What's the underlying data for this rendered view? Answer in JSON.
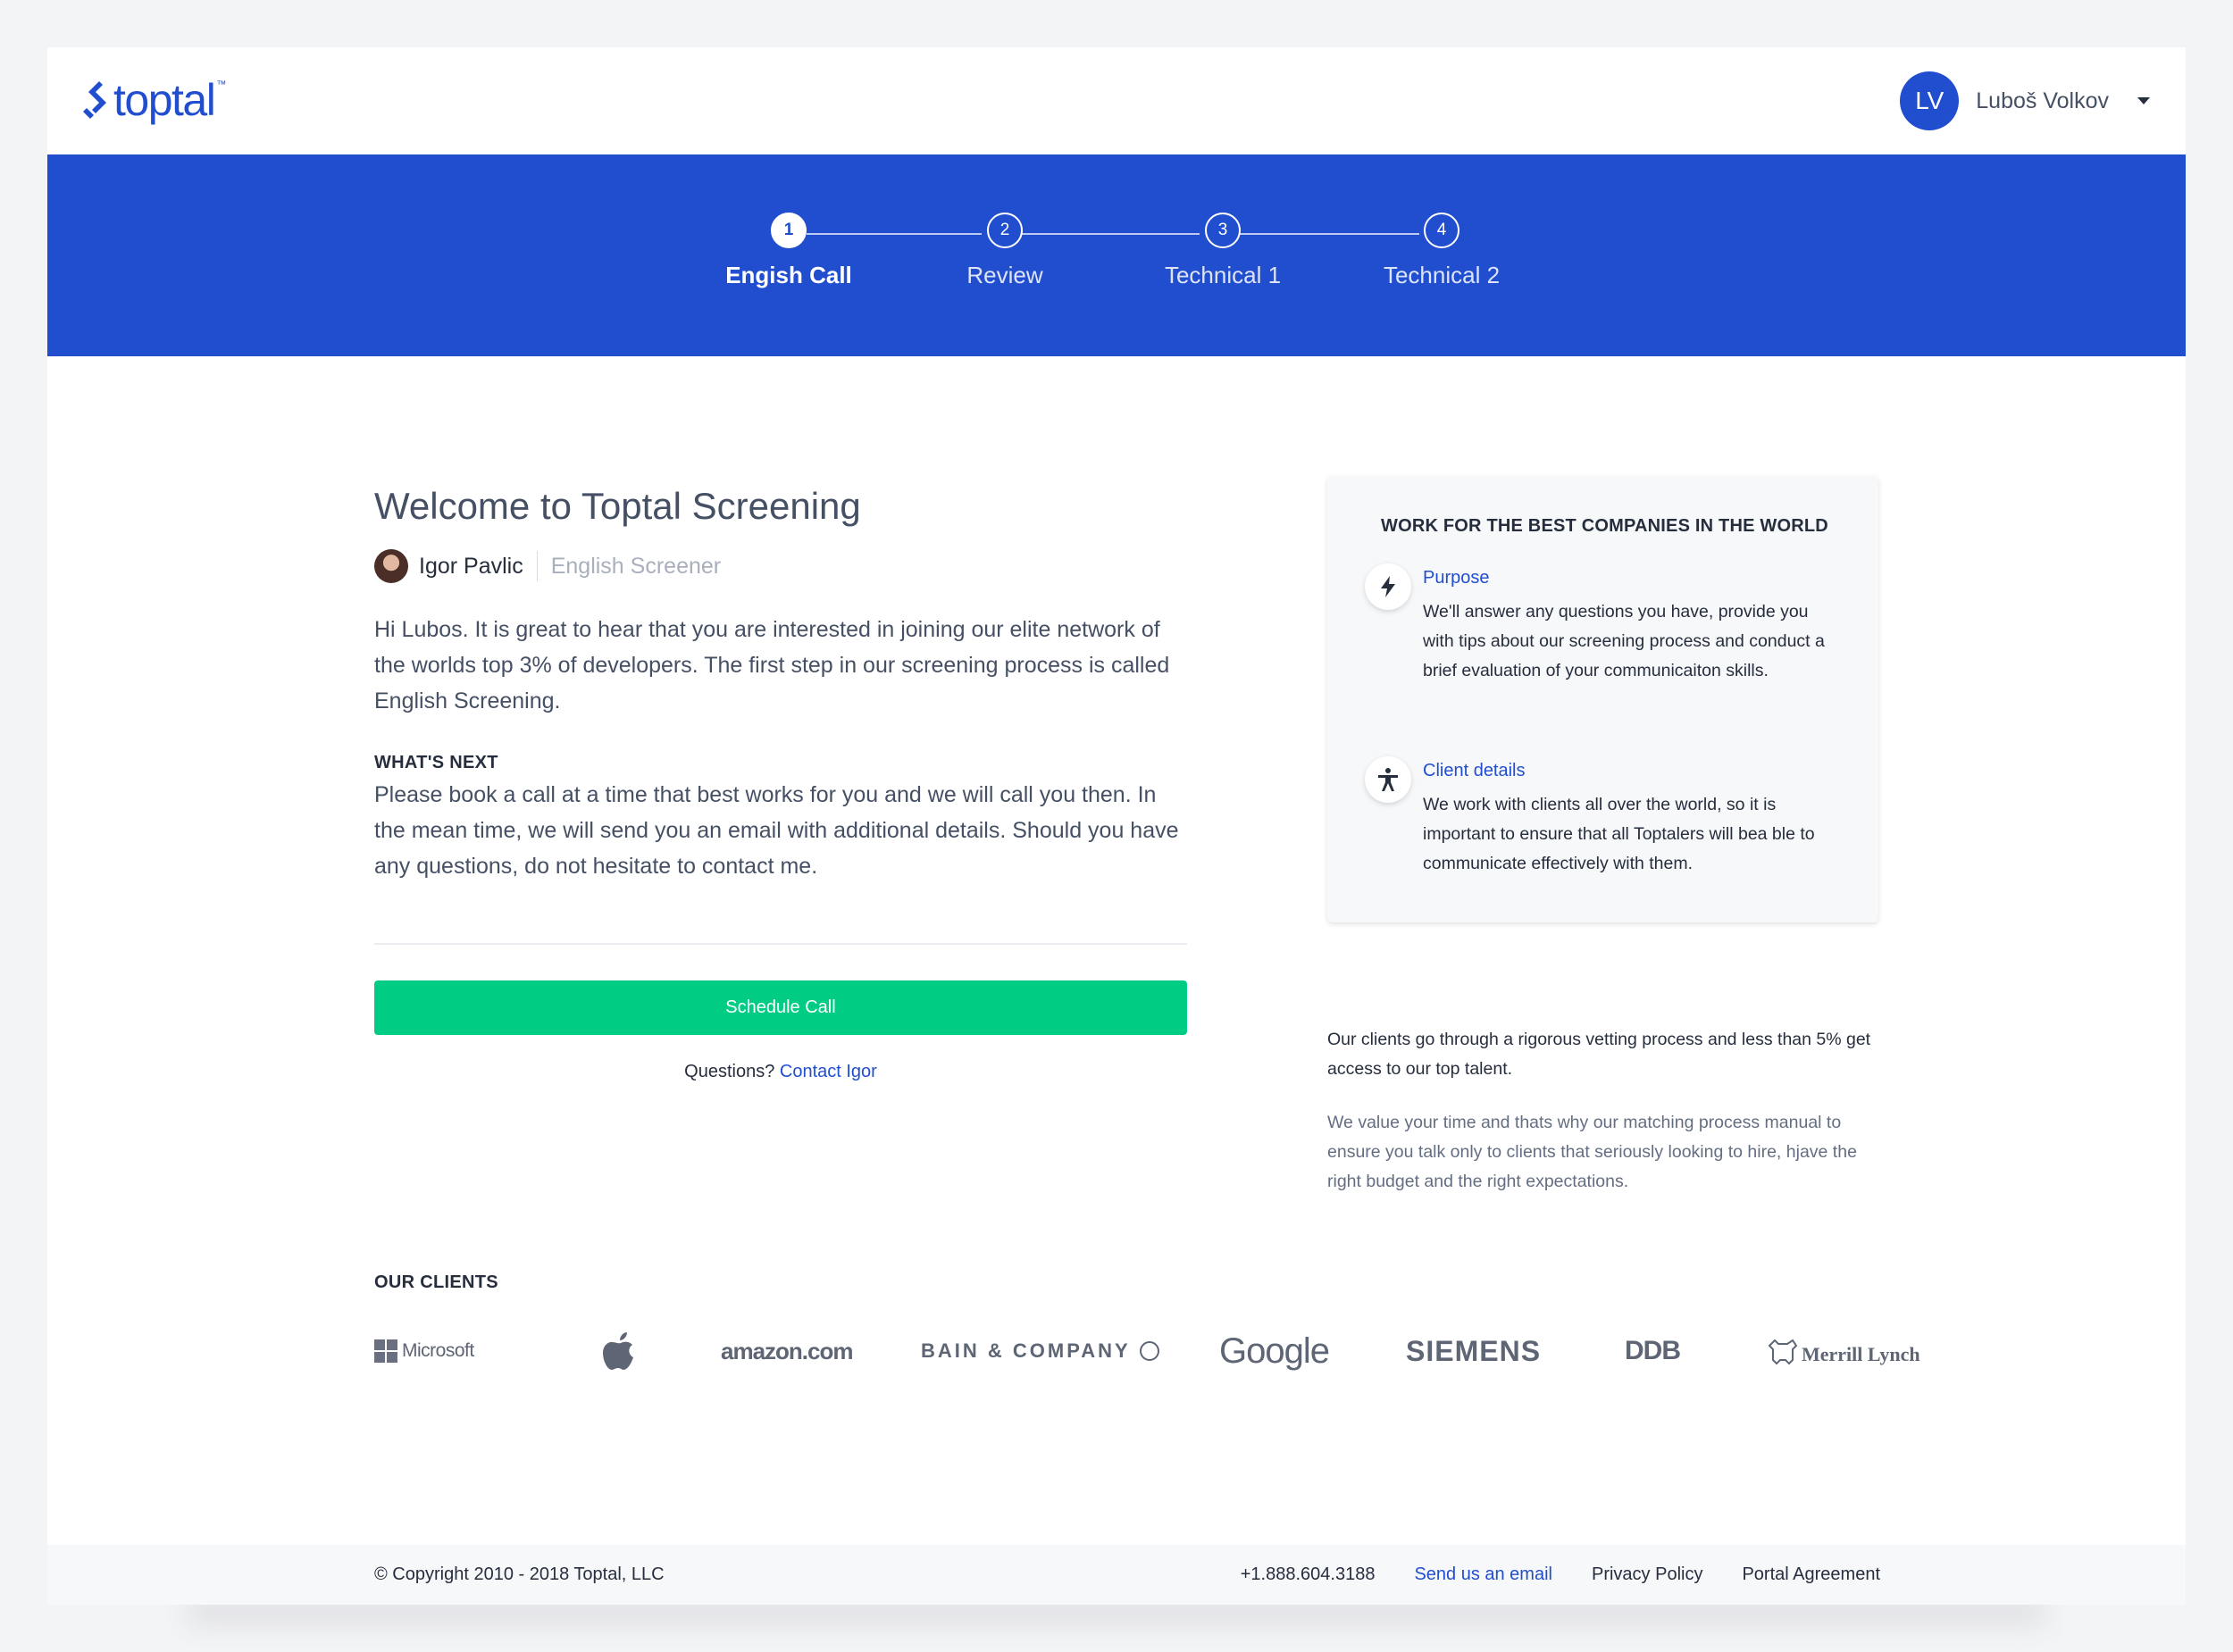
{
  "header": {
    "logo_text": "toptal",
    "logo_tm": "™",
    "user_initials": "LV",
    "user_name": "Luboš Volkov"
  },
  "steps": [
    {
      "number": "1",
      "label": "Engish Call",
      "active": true
    },
    {
      "number": "2",
      "label": "Review",
      "active": false
    },
    {
      "number": "3",
      "label": "Technical 1",
      "active": false
    },
    {
      "number": "4",
      "label": "Technical 2",
      "active": false
    }
  ],
  "main": {
    "title": "Welcome to Toptal Screening",
    "screener_name": "Igor Pavlic",
    "screener_role": "English Screener",
    "intro": "Hi Lubos. It is great to hear that you are interested in joining our elite network of the worlds top 3% of developers. The first step in our screening process is called English Screening.",
    "whats_next_heading": "WHAT'S NEXT",
    "whats_next_text": "Please book a call at a time that best works for you and we will call you then. In the mean time, we will send you an email with additional details. Should you have any questions, do not hesitate to contact me.",
    "schedule_button": "Schedule Call",
    "questions_label": "Questions?",
    "contact_link": "Contact Igor"
  },
  "card": {
    "title": "WORK FOR THE BEST COMPANIES IN THE WORLD",
    "features": [
      {
        "icon": "lightning-icon",
        "title": "Purpose",
        "text": "We'll answer any questions you have, provide you with tips about our screening process and conduct a brief evaluation of your communicaiton skills."
      },
      {
        "icon": "accessibility-person-icon",
        "title": "Client details",
        "text": "We work with clients all over the world, so it is important to ensure that all Toptalers will bea ble to communicate effectively with them."
      }
    ]
  },
  "notes": {
    "vetting": "Our clients go through a rigorous vetting process and less than 5% get access to our top talent.",
    "matching": "We value your time and thats why our matching process manual to ensure you talk only to clients that seriously looking to hire, hjave the right budget and the right expectations."
  },
  "clients": {
    "title": "OUR CLIENTS",
    "logos": [
      "Microsoft",
      "Apple",
      "amazon.com",
      "BAIN & COMPANY",
      "Google",
      "SIEMENS",
      "DDB",
      "Merrill Lynch"
    ]
  },
  "footer": {
    "copyright": "© Copyright 2010 - 2018 Toptal, LLC",
    "phone": "+1.888.604.3188",
    "email_link": "Send us an email",
    "privacy": "Privacy Policy",
    "agreement": "Portal Agreement"
  },
  "colors": {
    "brand_blue": "#204ecf",
    "cta_green": "#00cc83"
  }
}
